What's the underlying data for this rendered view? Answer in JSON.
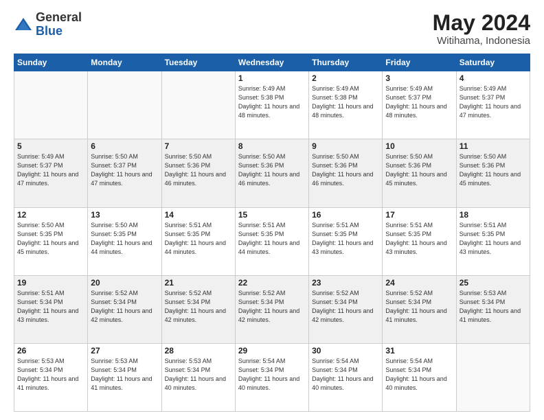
{
  "header": {
    "logo_general": "General",
    "logo_blue": "Blue",
    "month_year": "May 2024",
    "location": "Witihama, Indonesia"
  },
  "days_of_week": [
    "Sunday",
    "Monday",
    "Tuesday",
    "Wednesday",
    "Thursday",
    "Friday",
    "Saturday"
  ],
  "weeks": [
    [
      {
        "day": "",
        "info": ""
      },
      {
        "day": "",
        "info": ""
      },
      {
        "day": "",
        "info": ""
      },
      {
        "day": "1",
        "info": "Sunrise: 5:49 AM\nSunset: 5:38 PM\nDaylight: 11 hours\nand 48 minutes."
      },
      {
        "day": "2",
        "info": "Sunrise: 5:49 AM\nSunset: 5:38 PM\nDaylight: 11 hours\nand 48 minutes."
      },
      {
        "day": "3",
        "info": "Sunrise: 5:49 AM\nSunset: 5:37 PM\nDaylight: 11 hours\nand 48 minutes."
      },
      {
        "day": "4",
        "info": "Sunrise: 5:49 AM\nSunset: 5:37 PM\nDaylight: 11 hours\nand 47 minutes."
      }
    ],
    [
      {
        "day": "5",
        "info": "Sunrise: 5:49 AM\nSunset: 5:37 PM\nDaylight: 11 hours\nand 47 minutes."
      },
      {
        "day": "6",
        "info": "Sunrise: 5:50 AM\nSunset: 5:37 PM\nDaylight: 11 hours\nand 47 minutes."
      },
      {
        "day": "7",
        "info": "Sunrise: 5:50 AM\nSunset: 5:36 PM\nDaylight: 11 hours\nand 46 minutes."
      },
      {
        "day": "8",
        "info": "Sunrise: 5:50 AM\nSunset: 5:36 PM\nDaylight: 11 hours\nand 46 minutes."
      },
      {
        "day": "9",
        "info": "Sunrise: 5:50 AM\nSunset: 5:36 PM\nDaylight: 11 hours\nand 46 minutes."
      },
      {
        "day": "10",
        "info": "Sunrise: 5:50 AM\nSunset: 5:36 PM\nDaylight: 11 hours\nand 45 minutes."
      },
      {
        "day": "11",
        "info": "Sunrise: 5:50 AM\nSunset: 5:36 PM\nDaylight: 11 hours\nand 45 minutes."
      }
    ],
    [
      {
        "day": "12",
        "info": "Sunrise: 5:50 AM\nSunset: 5:35 PM\nDaylight: 11 hours\nand 45 minutes."
      },
      {
        "day": "13",
        "info": "Sunrise: 5:50 AM\nSunset: 5:35 PM\nDaylight: 11 hours\nand 44 minutes."
      },
      {
        "day": "14",
        "info": "Sunrise: 5:51 AM\nSunset: 5:35 PM\nDaylight: 11 hours\nand 44 minutes."
      },
      {
        "day": "15",
        "info": "Sunrise: 5:51 AM\nSunset: 5:35 PM\nDaylight: 11 hours\nand 44 minutes."
      },
      {
        "day": "16",
        "info": "Sunrise: 5:51 AM\nSunset: 5:35 PM\nDaylight: 11 hours\nand 43 minutes."
      },
      {
        "day": "17",
        "info": "Sunrise: 5:51 AM\nSunset: 5:35 PM\nDaylight: 11 hours\nand 43 minutes."
      },
      {
        "day": "18",
        "info": "Sunrise: 5:51 AM\nSunset: 5:35 PM\nDaylight: 11 hours\nand 43 minutes."
      }
    ],
    [
      {
        "day": "19",
        "info": "Sunrise: 5:51 AM\nSunset: 5:34 PM\nDaylight: 11 hours\nand 43 minutes."
      },
      {
        "day": "20",
        "info": "Sunrise: 5:52 AM\nSunset: 5:34 PM\nDaylight: 11 hours\nand 42 minutes."
      },
      {
        "day": "21",
        "info": "Sunrise: 5:52 AM\nSunset: 5:34 PM\nDaylight: 11 hours\nand 42 minutes."
      },
      {
        "day": "22",
        "info": "Sunrise: 5:52 AM\nSunset: 5:34 PM\nDaylight: 11 hours\nand 42 minutes."
      },
      {
        "day": "23",
        "info": "Sunrise: 5:52 AM\nSunset: 5:34 PM\nDaylight: 11 hours\nand 42 minutes."
      },
      {
        "day": "24",
        "info": "Sunrise: 5:52 AM\nSunset: 5:34 PM\nDaylight: 11 hours\nand 41 minutes."
      },
      {
        "day": "25",
        "info": "Sunrise: 5:53 AM\nSunset: 5:34 PM\nDaylight: 11 hours\nand 41 minutes."
      }
    ],
    [
      {
        "day": "26",
        "info": "Sunrise: 5:53 AM\nSunset: 5:34 PM\nDaylight: 11 hours\nand 41 minutes."
      },
      {
        "day": "27",
        "info": "Sunrise: 5:53 AM\nSunset: 5:34 PM\nDaylight: 11 hours\nand 41 minutes."
      },
      {
        "day": "28",
        "info": "Sunrise: 5:53 AM\nSunset: 5:34 PM\nDaylight: 11 hours\nand 40 minutes."
      },
      {
        "day": "29",
        "info": "Sunrise: 5:54 AM\nSunset: 5:34 PM\nDaylight: 11 hours\nand 40 minutes."
      },
      {
        "day": "30",
        "info": "Sunrise: 5:54 AM\nSunset: 5:34 PM\nDaylight: 11 hours\nand 40 minutes."
      },
      {
        "day": "31",
        "info": "Sunrise: 5:54 AM\nSunset: 5:34 PM\nDaylight: 11 hours\nand 40 minutes."
      },
      {
        "day": "",
        "info": ""
      }
    ]
  ]
}
